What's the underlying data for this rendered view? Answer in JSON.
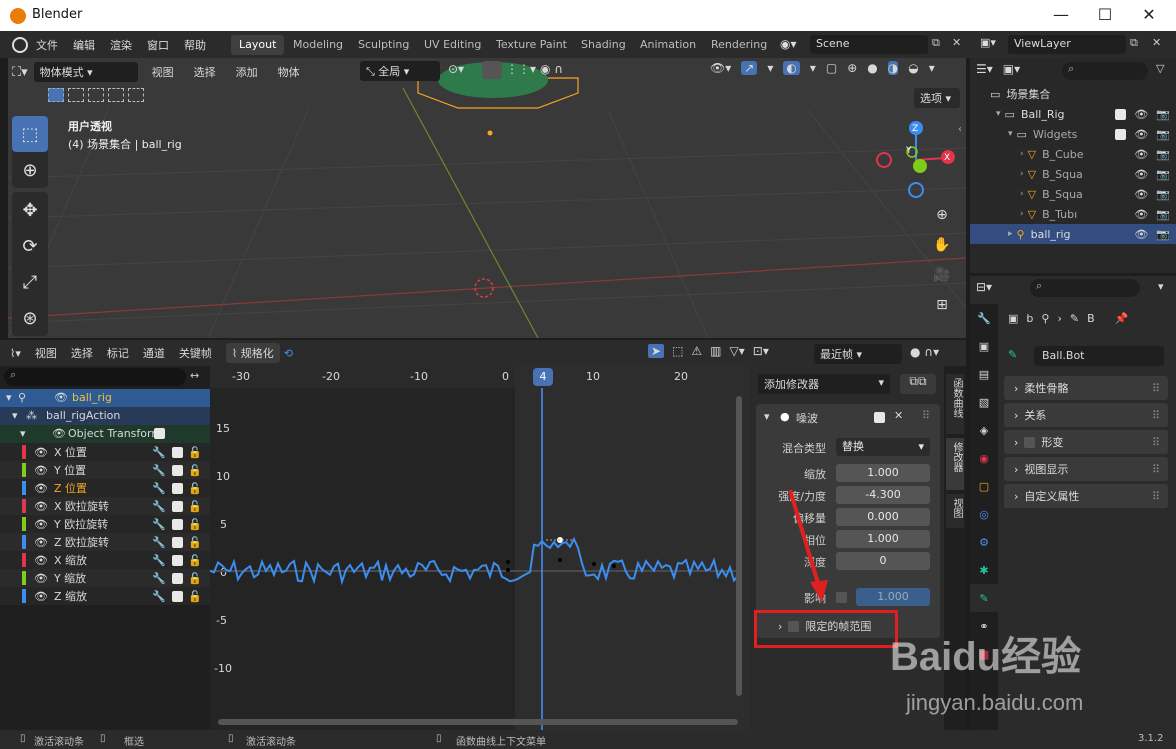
{
  "window": {
    "title": "Blender",
    "minimize": "—",
    "maximize": "☐",
    "close": "✕"
  },
  "menu": [
    "文件",
    "编辑",
    "渲染",
    "窗口",
    "帮助"
  ],
  "workspaces": [
    "Layout",
    "Modeling",
    "Sculpting",
    "UV Editing",
    "Texture Paint",
    "Shading",
    "Animation",
    "Rendering"
  ],
  "active_workspace": "Layout",
  "scene": {
    "name": "Scene"
  },
  "view_layer": {
    "name": "ViewLayer"
  },
  "viewport": {
    "mode": "物体模式",
    "menus": [
      "视图",
      "选择",
      "添加",
      "物体"
    ],
    "transform_orientation": "全局",
    "options_label": "选项",
    "overlay_title": "用户透视",
    "overlay_subtitle": "(4) 场景集合 | ball_rig",
    "gizmo": {
      "z": "Z",
      "x": "X",
      "y": "Y"
    }
  },
  "graph_editor": {
    "menus": [
      "视图",
      "选择",
      "标记",
      "通道",
      "关键帧"
    ],
    "normalize_label": "规格化",
    "interpolation": "最近帧",
    "current_frame": "4",
    "frame_ticks": [
      "-30",
      "-20",
      "-10",
      "0",
      "10",
      "20"
    ],
    "value_ticks": [
      "15",
      "10",
      "5",
      "0",
      "-5",
      "-10"
    ],
    "channels": [
      {
        "name": "ball_rig",
        "type": "object"
      },
      {
        "name": "ball_rigAction",
        "type": "action"
      },
      {
        "name": "Object Transform",
        "type": "group"
      },
      {
        "name": "X 位置",
        "color": "#e0354a"
      },
      {
        "name": "Y 位置",
        "color": "#7fcc1b"
      },
      {
        "name": "Z 位置",
        "color": "#3b8ef0"
      },
      {
        "name": "X 欧拉旋转",
        "color": "#e0354a"
      },
      {
        "name": "Y 欧拉旋转",
        "color": "#7fcc1b"
      },
      {
        "name": "Z 欧拉旋转",
        "color": "#3b8ef0"
      },
      {
        "name": "X 缩放",
        "color": "#e0354a"
      },
      {
        "name": "Y 缩放",
        "color": "#7fcc1b"
      },
      {
        "name": "Z 缩放",
        "color": "#3b8ef0"
      }
    ],
    "modifier_panel": {
      "add_modifier": "添加修改器",
      "modifier_name": "噪波",
      "blend_type_label": "混合类型",
      "blend_type_value": "替换",
      "fields": [
        {
          "label": "缩放",
          "value": "1.000"
        },
        {
          "label": "强度/力度",
          "value": "-4.300"
        },
        {
          "label": "偏移量",
          "value": "0.000"
        },
        {
          "label": "相位",
          "value": "1.000"
        },
        {
          "label": "深度",
          "value": "0"
        }
      ],
      "influence_label": "影响",
      "influence_value": "1.000",
      "restrict_frame_range": "限定的帧范围"
    },
    "side_tabs": [
      "函数曲线",
      "修改器",
      "视图"
    ]
  },
  "outliner": {
    "root": "场景集合",
    "items": [
      {
        "name": "Ball_Rig",
        "indent": 1
      },
      {
        "name": "Widgets",
        "indent": 2
      },
      {
        "name": "B_Cube",
        "indent": 3
      },
      {
        "name": "B_Squa",
        "indent": 3
      },
      {
        "name": "B_Squa",
        "indent": 3
      },
      {
        "name": "B_Tubı",
        "indent": 3
      },
      {
        "name": "ball_rig",
        "indent": 2,
        "selected": true
      }
    ]
  },
  "properties": {
    "breadcrumb": [
      "b",
      "B"
    ],
    "bone_name": "Ball.Bot",
    "panels": [
      "柔性骨骼",
      "关系",
      "形变",
      "视图显示",
      "自定义属性"
    ]
  },
  "statusbar": {
    "items": [
      "激活滚动条",
      "框选",
      "激活滚动条",
      "函数曲线上下文菜单"
    ],
    "version": "3.1.2"
  },
  "watermark": {
    "text": "Baidu经验",
    "url": "jingyan.baidu.com"
  },
  "colors": {
    "accent": "#4772b3",
    "highlight": "#e02020",
    "curve": "#3b8ef0",
    "orange": "#f5a623"
  }
}
